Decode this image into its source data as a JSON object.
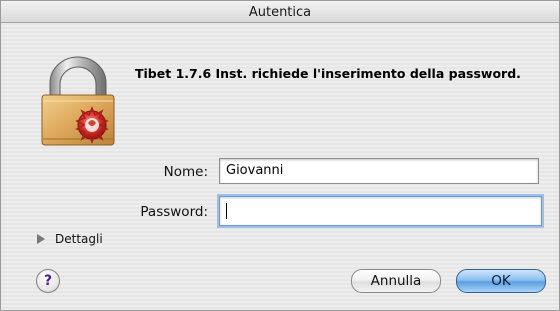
{
  "window": {
    "title": "Autentica"
  },
  "dialog": {
    "message": "Tibet 1.7.6 Inst. richiede l'inserimento della password.",
    "icon": "lock-icon"
  },
  "form": {
    "name_label": "Nome:",
    "name_value": "Giovanni",
    "password_label": "Password:",
    "password_value": ""
  },
  "details": {
    "label": "Dettagli",
    "icon": "disclosure-triangle-icon"
  },
  "buttons": {
    "help_label": "?",
    "cancel_label": "Annulla",
    "ok_label": "OK"
  }
}
